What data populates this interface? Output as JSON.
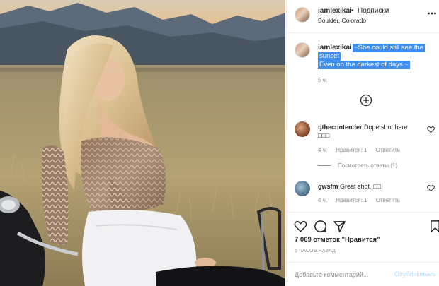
{
  "post": {
    "username": "iamlexikai",
    "separator": "•",
    "follow_label": "Подписки",
    "location": "Boulder, Colorado"
  },
  "caption": {
    "username": "iamlexikai",
    "line1": "~She could still see the",
    "line2": "sunset",
    "line3": "Even on the darkest of days ~",
    "time": "5 ч."
  },
  "comments": [
    {
      "username": "tjthecontender",
      "text": "Dope shot here",
      "emoji": "□□□",
      "time": "4 ч.",
      "likes": "Нравится: 1",
      "reply": "Ответить",
      "view_replies": "Посмотреть ответы (1)"
    },
    {
      "username": "gwsfm",
      "text": "Great shot.",
      "emoji": "□□",
      "time": "4 ч.",
      "likes": "Нравится: 1",
      "reply": "Ответить"
    }
  ],
  "stats": {
    "likes": "7 069 отметок \"Нравится\"",
    "ago": "5 ЧАСОВ НАЗАД"
  },
  "comment_box": {
    "placeholder": "Добавьте комментарий...",
    "publish_label": "Опубликовать"
  },
  "icons": {
    "more": "more-dots-icon",
    "load_more": "plus-circle-icon",
    "like": "heart-icon",
    "comment": "comment-bubble-icon",
    "share": "paper-plane-icon",
    "save": "bookmark-icon"
  },
  "colors": {
    "selection": "#3e8eef",
    "publish_disabled": "#b2dffc",
    "muted": "#8e8e8e"
  }
}
